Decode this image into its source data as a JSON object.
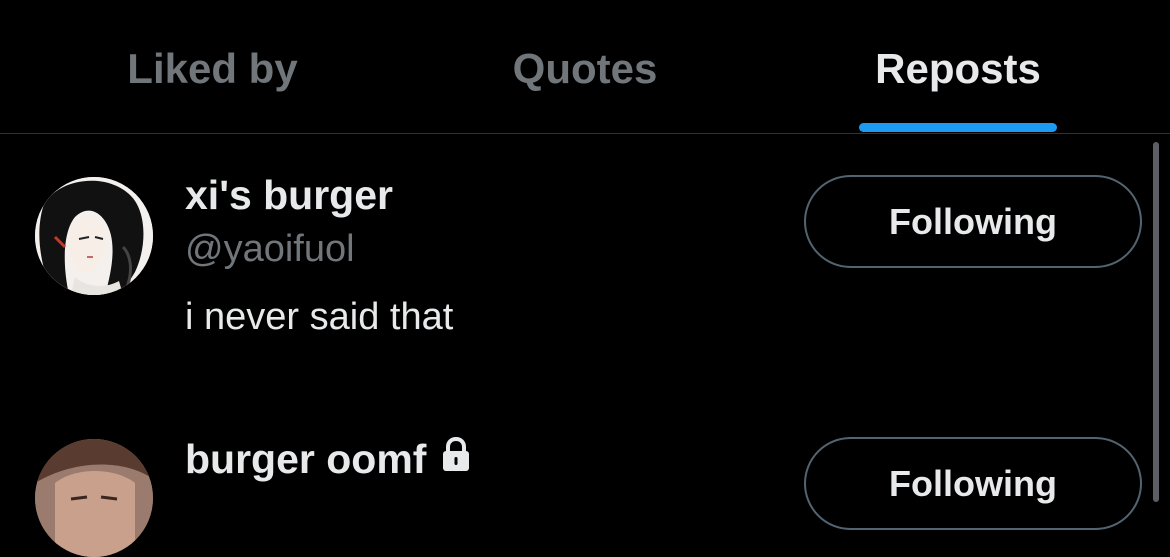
{
  "tabs": [
    {
      "label": "Liked by",
      "active": false
    },
    {
      "label": "Quotes",
      "active": false
    },
    {
      "label": "Reposts",
      "active": true
    }
  ],
  "accent_color": "#1d9bf0",
  "users": [
    {
      "display_name": "xi's burger",
      "handle": "@yaoifuol",
      "bio": "i never said that",
      "follow_label": "Following",
      "protected": false
    },
    {
      "display_name": "burger oomf",
      "follow_label": "Following",
      "protected": true,
      "protected_icon": "lock-icon"
    }
  ]
}
